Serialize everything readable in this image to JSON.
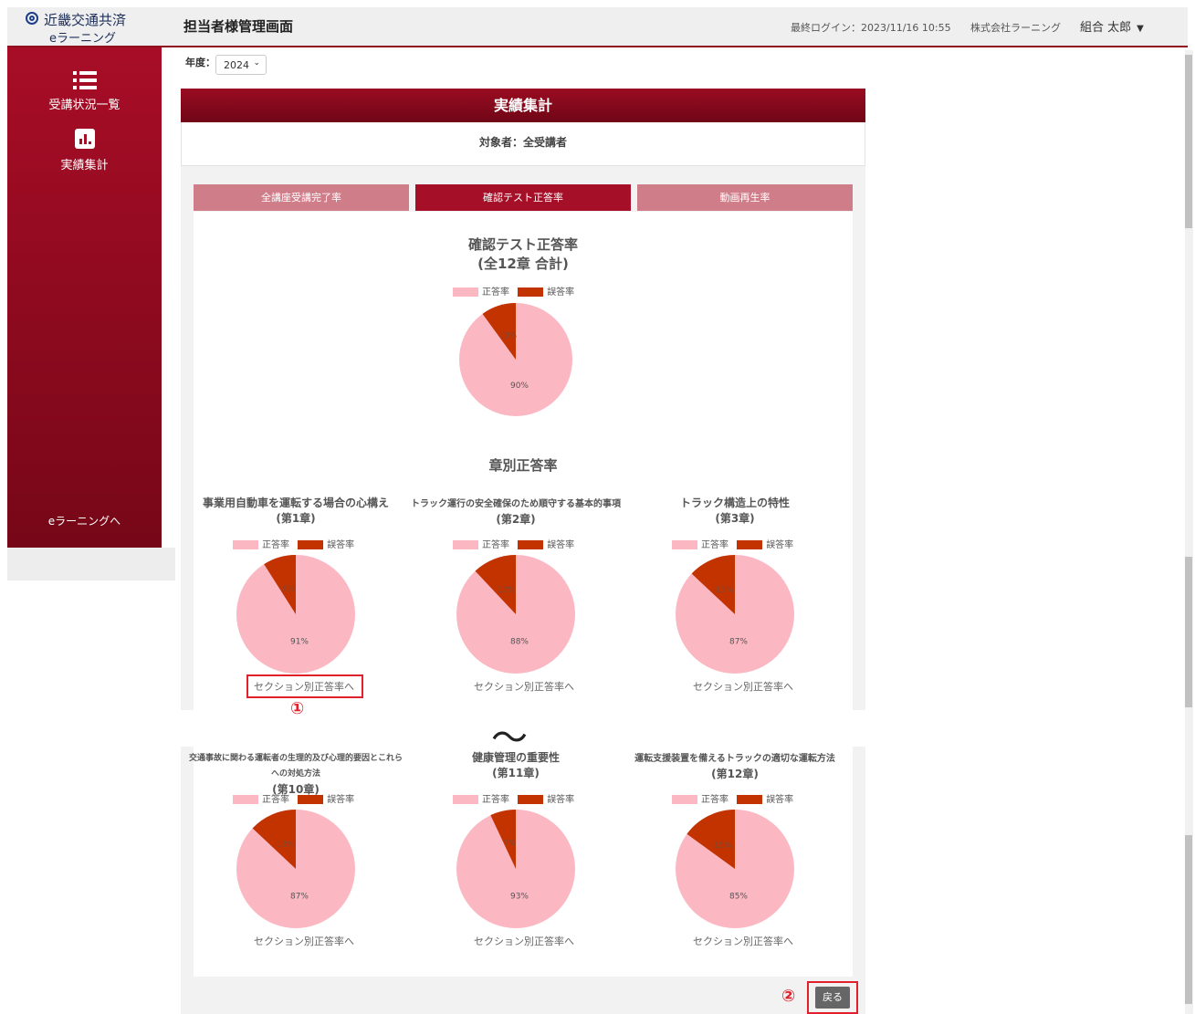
{
  "header": {
    "logo_name": "近畿交通共済",
    "logo_sub": "eラーニング",
    "page_title": "担当者様管理画面",
    "last_login": "最終ログイン：2023/11/16 10:55",
    "company": "株式会社ラーニング",
    "user_name": "組合 太郎"
  },
  "sidebar": {
    "items": [
      {
        "label": "受講状況一覧",
        "icon": "list-icon"
      },
      {
        "label": "実績集計",
        "icon": "bar-chart-icon"
      }
    ],
    "bottom_link": "eラーニングへ"
  },
  "filter": {
    "year_label": "年度：",
    "year_value": "2024"
  },
  "panel": {
    "title": "実績集計",
    "target": "対象者：全受講者",
    "tabs": [
      {
        "label": "全講座受講完了率",
        "active": false
      },
      {
        "label": "確認テスト正答率",
        "active": true
      },
      {
        "label": "動画再生率",
        "active": false
      }
    ]
  },
  "legend": {
    "correct": "正答率",
    "wrong": "誤答率"
  },
  "colors": {
    "correct": "#fbb8c3",
    "wrong": "#c23300",
    "accent": "#a50f27"
  },
  "overall": {
    "title_line1": "確認テスト正答率",
    "title_line2": "(全12章 合計)"
  },
  "section_title": "章別正答率",
  "link_label": "セクション別正答率へ",
  "chart_data": [
    {
      "type": "pie",
      "title": "確認テスト正答率 (全12章 合計)",
      "categories": [
        "正答率",
        "誤答率"
      ],
      "values": [
        90,
        10
      ],
      "labels": [
        "90%",
        "10%"
      ]
    },
    {
      "type": "pie",
      "title": "事業用自動車を運転する場合の心構え (第1章)",
      "categories": [
        "正答率",
        "誤答率"
      ],
      "values": [
        91,
        9
      ],
      "labels": [
        "91%",
        "9%"
      ]
    },
    {
      "type": "pie",
      "title": "トラック運行の安全確保のため順守する基本的事項 (第2章)",
      "categories": [
        "正答率",
        "誤答率"
      ],
      "values": [
        88,
        12
      ],
      "labels": [
        "88%",
        "12%"
      ]
    },
    {
      "type": "pie",
      "title": "トラック構造上の特性 (第3章)",
      "categories": [
        "正答率",
        "誤答率"
      ],
      "values": [
        87,
        13
      ],
      "labels": [
        "87%",
        "13%"
      ]
    },
    {
      "type": "pie",
      "title": "交通事故に関わる運転者の生理的及び心理的要因とこれらへの対処方法 (第10章)",
      "categories": [
        "正答率",
        "誤答率"
      ],
      "values": [
        87,
        13
      ],
      "labels": [
        "87%",
        "13%"
      ]
    },
    {
      "type": "pie",
      "title": "健康管理の重要性 (第11章)",
      "categories": [
        "正答率",
        "誤答率"
      ],
      "values": [
        93,
        7
      ],
      "labels": [
        "93%",
        "7%"
      ]
    },
    {
      "type": "pie",
      "title": "運転支援装置を備えるトラックの適切な運転方法 (第12章)",
      "categories": [
        "正答率",
        "誤答率"
      ],
      "values": [
        85,
        15
      ],
      "labels": [
        "85%",
        "15%"
      ]
    }
  ],
  "chapters": [
    {
      "title": "事業用自動車を運転する場合の心構え",
      "sub": "(第1章)"
    },
    {
      "title": "トラック運行の安全確保のため順守する基本的事項",
      "sub": "(第2章)"
    },
    {
      "title": "トラック構造上の特性",
      "sub": "(第3章)"
    },
    {
      "title": "交通事故に関わる運転者の生理的及び心理的要因とこれらへの対処方法",
      "sub": "(第10章)"
    },
    {
      "title": "健康管理の重要性",
      "sub": "(第11章)"
    },
    {
      "title": "運転支援装置を備えるトラックの適切な運転方法",
      "sub": "(第12章)"
    }
  ],
  "annotations": {
    "marker1": "①",
    "marker2": "②",
    "separator": "〜"
  },
  "back_label": "戻る"
}
